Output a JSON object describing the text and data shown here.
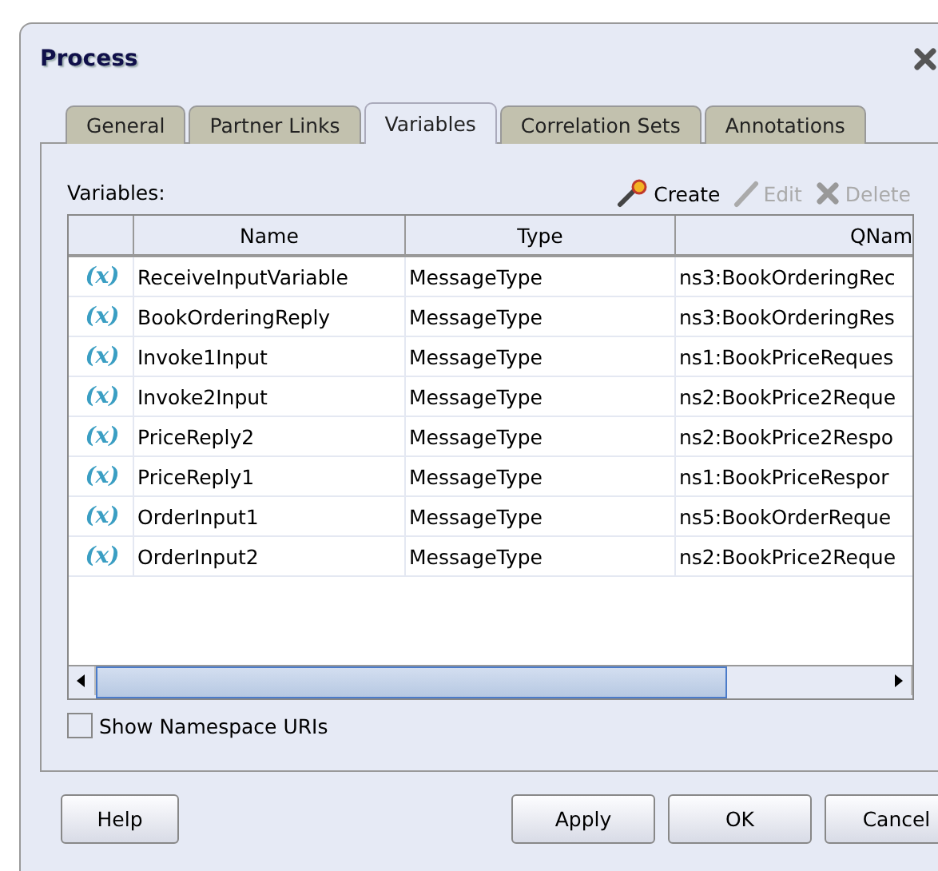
{
  "window": {
    "title": "Process"
  },
  "tabs": [
    {
      "label": "General",
      "selected": false
    },
    {
      "label": "Partner Links",
      "selected": false
    },
    {
      "label": "Variables",
      "selected": true
    },
    {
      "label": "Correlation Sets",
      "selected": false
    },
    {
      "label": "Annotations",
      "selected": false
    }
  ],
  "variables_label": "Variables:",
  "toolbar": [
    {
      "kind": "create",
      "label": "Create",
      "disabled": false
    },
    {
      "kind": "edit",
      "label": "Edit",
      "disabled": true
    },
    {
      "kind": "delete",
      "label": "Delete",
      "disabled": true
    }
  ],
  "table": {
    "columns": [
      "Name",
      "Type",
      "QNam"
    ],
    "rows": [
      {
        "icon": "(x)",
        "name": "ReceiveInputVariable",
        "type": "MessageType",
        "qname": "ns3:BookOrderingRec"
      },
      {
        "icon": "(x)",
        "name": "BookOrderingReply",
        "type": "MessageType",
        "qname": "ns3:BookOrderingRes"
      },
      {
        "icon": "(x)",
        "name": "Invoke1Input",
        "type": "MessageType",
        "qname": "ns1:BookPriceReques"
      },
      {
        "icon": "(x)",
        "name": "Invoke2Input",
        "type": "MessageType",
        "qname": "ns2:BookPrice2Reque"
      },
      {
        "icon": "(x)",
        "name": "PriceReply2",
        "type": "MessageType",
        "qname": "ns2:BookPrice2Respo"
      },
      {
        "icon": "(x)",
        "name": "PriceReply1",
        "type": "MessageType",
        "qname": "ns1:BookPriceRespor"
      },
      {
        "icon": "(x)",
        "name": "OrderInput1",
        "type": "MessageType",
        "qname": "ns5:BookOrderReque"
      },
      {
        "icon": "(x)",
        "name": "OrderInput2",
        "type": "MessageType",
        "qname": "ns2:BookPrice2Reque"
      }
    ]
  },
  "show_namespace": {
    "label": "Show Namespace URIs",
    "checked": false
  },
  "buttons": [
    "Help",
    "Apply",
    "OK",
    "Cancel"
  ]
}
